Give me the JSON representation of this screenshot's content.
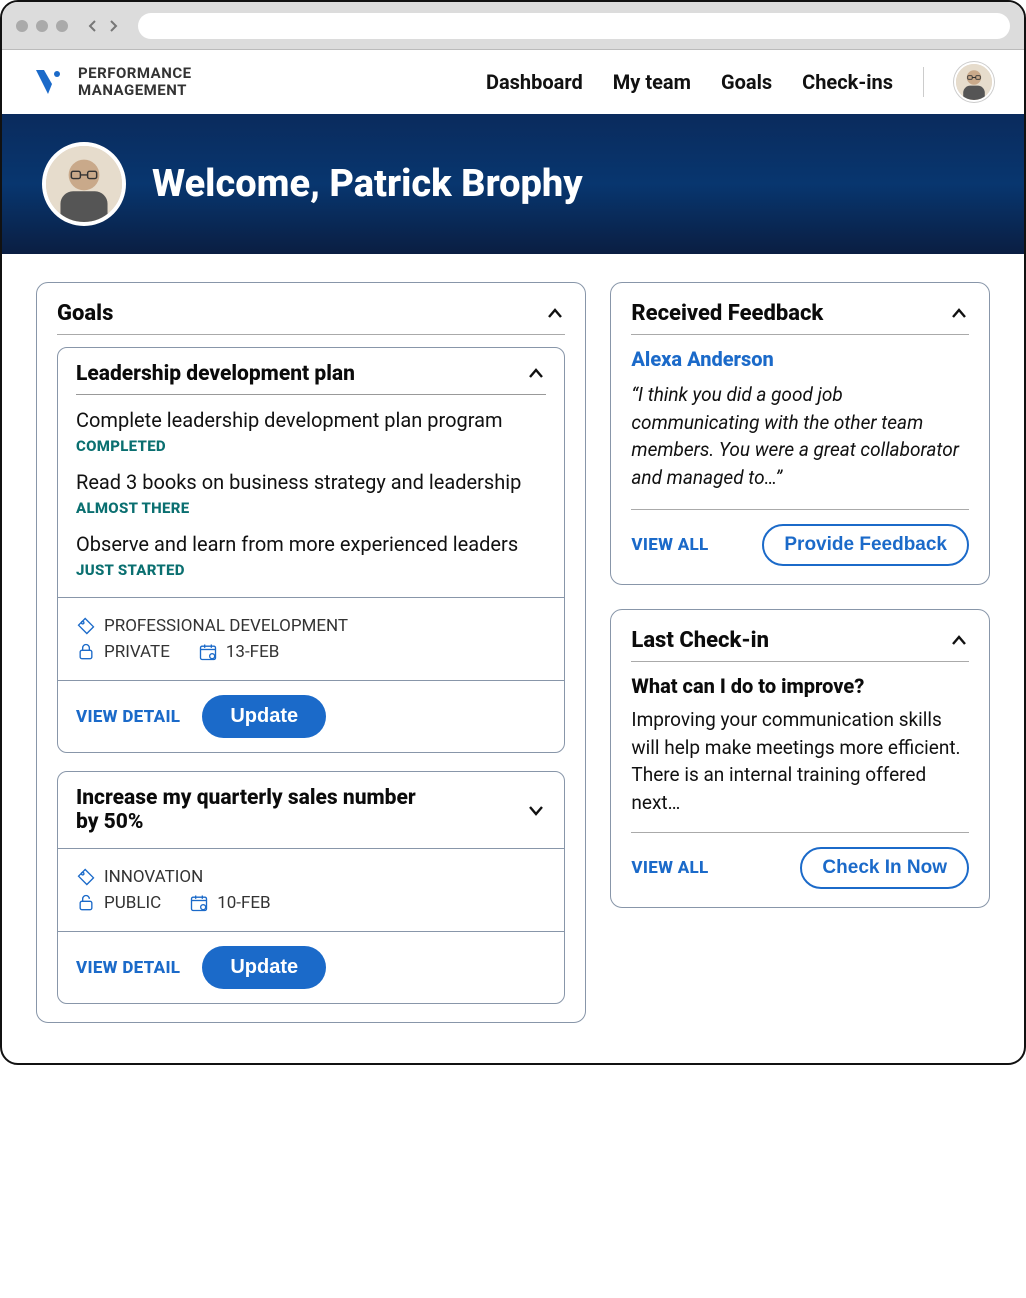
{
  "brand": {
    "line1": "PERFORMANCE",
    "line2": "MANAGEMENT"
  },
  "nav": {
    "dashboard": "Dashboard",
    "myteam": "My team",
    "goals": "Goals",
    "checkins": "Check-ins"
  },
  "hero": {
    "welcome": "Welcome, Patrick Brophy"
  },
  "goals_panel": {
    "title": "Goals",
    "cards": [
      {
        "title": "Leadership development plan",
        "items": [
          {
            "text": "Complete leadership development plan program",
            "status": "COMPLETED"
          },
          {
            "text": "Read 3 books on business strategy and leadership",
            "status": "ALMOST THERE"
          },
          {
            "text": "Observe and learn from more experienced leaders",
            "status": "JUST STARTED"
          }
        ],
        "tag": "PROFESSIONAL DEVELOPMENT",
        "visibility": "PRIVATE",
        "date": "13-FEB",
        "view_detail": "VIEW DETAIL",
        "update": "Update"
      },
      {
        "title": "Increase my quarterly sales number by 50%",
        "tag": "INNOVATION",
        "visibility": "PUBLIC",
        "date": "10-FEB",
        "view_detail": "VIEW DETAIL",
        "update": "Update"
      }
    ]
  },
  "feedback_panel": {
    "title": "Received Feedback",
    "from": "Alexa Anderson",
    "quote": "“I think you did a good job communicating with the other team members. You were a great collaborator and managed to…”",
    "view_all": "VIEW ALL",
    "provide": "Provide Feedback"
  },
  "checkin_panel": {
    "title": "Last Check-in",
    "question": "What can I do to improve?",
    "body": "Improving your communication skills will help make meetings more efficient. There is an internal training offered next…",
    "view_all": "VIEW ALL",
    "checkin": "Check In Now"
  }
}
